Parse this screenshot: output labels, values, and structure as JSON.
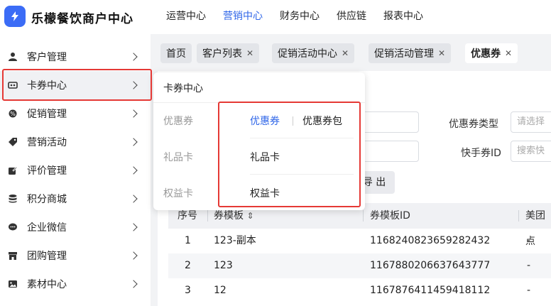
{
  "brand": {
    "name": "乐檬餐饮商户中心"
  },
  "topnav": [
    {
      "label": "运营中心",
      "active": false
    },
    {
      "label": "营销中心",
      "active": true
    },
    {
      "label": "财务中心",
      "active": false
    },
    {
      "label": "供应链",
      "active": false
    },
    {
      "label": "报表中心",
      "active": false
    }
  ],
  "sidebar": {
    "items": [
      {
        "label": "客户管理",
        "icon": "user-icon"
      },
      {
        "label": "卡券中心",
        "icon": "ticket-icon"
      },
      {
        "label": "促销管理",
        "icon": "gear-badge-icon"
      },
      {
        "label": "营销活动",
        "icon": "tag-icon"
      },
      {
        "label": "评价管理",
        "icon": "edit-icon"
      },
      {
        "label": "积分商城",
        "icon": "database-icon"
      },
      {
        "label": "企业微信",
        "icon": "chat-icon"
      },
      {
        "label": "团购管理",
        "icon": "store-icon"
      },
      {
        "label": "素材中心",
        "icon": "image-icon"
      }
    ]
  },
  "tabs": [
    {
      "label": "首页",
      "closable": false
    },
    {
      "label": "客户列表",
      "closable": true
    },
    {
      "label": "促销活动中心",
      "closable": true
    },
    {
      "label": "促销活动管理",
      "closable": true
    },
    {
      "label": "优惠券",
      "closable": true
    }
  ],
  "filters": {
    "coupon_type_label": "优惠券类型",
    "coupon_type_placeholder": "请选择",
    "kuaishou_id_label": "快手券ID",
    "kuaishou_id_placeholder": "搜索快"
  },
  "export_label": "导 出",
  "table": {
    "headers": [
      "序号",
      "券模板",
      "券模板ID",
      "美团点"
    ],
    "rows": [
      [
        "1",
        "123-副本",
        "1168240823659282432",
        "-"
      ],
      [
        "2",
        "123",
        "1167880206637643777",
        "-"
      ],
      [
        "3",
        "12",
        "1167876411459418112",
        "-"
      ]
    ]
  },
  "popup": {
    "title": "卡券中心",
    "categories": [
      "优惠券",
      "礼品卡",
      "权益卡"
    ],
    "options": {
      "coupon": "优惠券",
      "coupon_pack": "优惠券包",
      "gift_card": "礼品卡",
      "benefit_card": "权益卡"
    }
  },
  "colors": {
    "accent": "#2f66e8",
    "highlight": "#e53935"
  }
}
